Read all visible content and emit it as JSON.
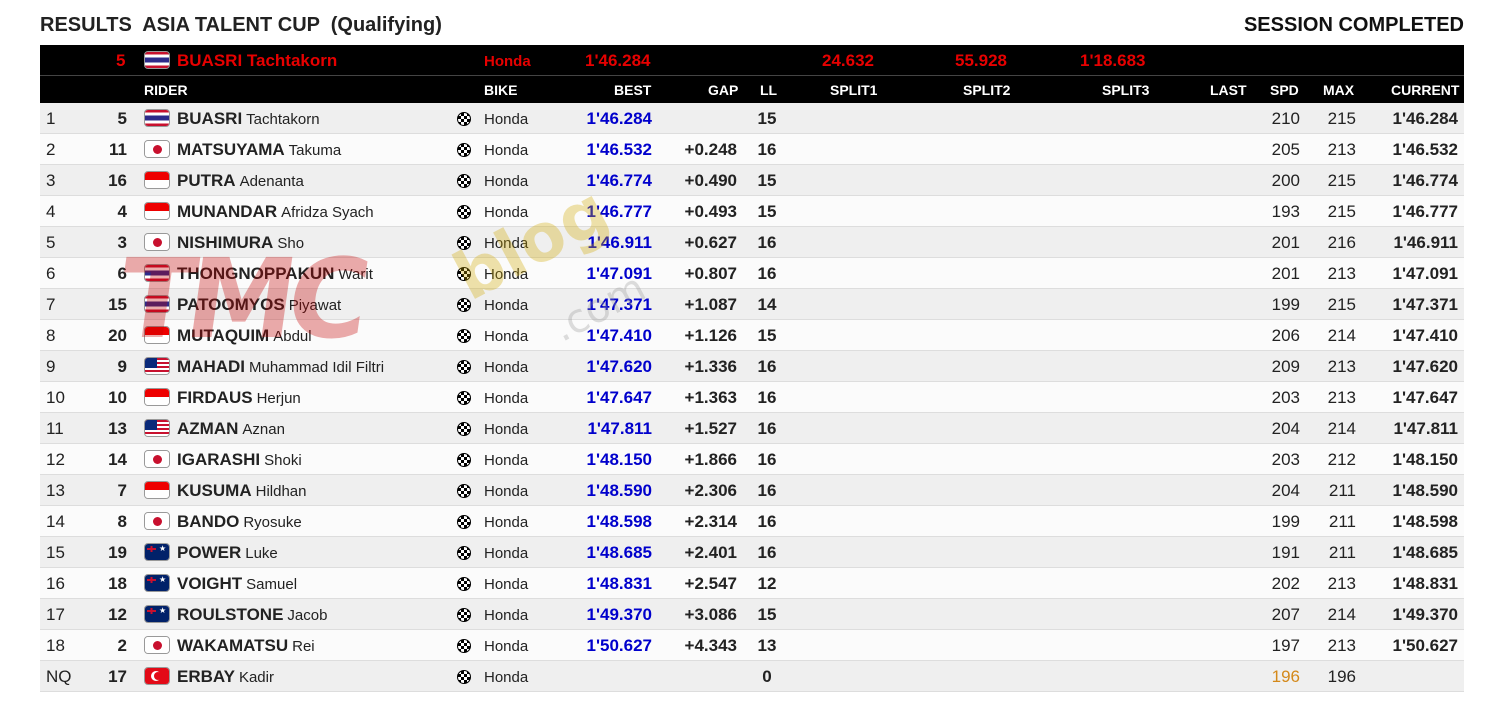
{
  "page": {
    "title": "RESULTS  ASIA TALENT CUP  (Qualifying)",
    "status": "SESSION COMPLETED"
  },
  "leader": {
    "number": "5",
    "flag": "flag-thailand",
    "rider": "BUASRI Tachtakorn",
    "bike": "Honda",
    "best": "1'46.284",
    "split1": "24.632",
    "split2": "55.928",
    "split3": "1'18.683"
  },
  "columns": {
    "rider": "RIDER",
    "bike": "BIKE",
    "best": "BEST",
    "gap": "GAP",
    "ll": "LL",
    "split1": "SPLIT1",
    "split2": "SPLIT2",
    "split3": "SPLIT3",
    "last": "LAST",
    "spd": "SPD",
    "max": "MAX",
    "current": "CURRENT"
  },
  "rows": [
    {
      "pos": "1",
      "num": "5",
      "flag": "th",
      "last_name": "BUASRI",
      "first_name": "Tachtakorn",
      "bike": "Honda",
      "best": "1'46.284",
      "gap": "",
      "ll": "15",
      "spd": "210",
      "max": "215",
      "current": "1'46.284"
    },
    {
      "pos": "2",
      "num": "11",
      "flag": "jp",
      "last_name": "MATSUYAMA",
      "first_name": "Takuma",
      "bike": "Honda",
      "best": "1'46.532",
      "gap": "+0.248",
      "ll": "16",
      "spd": "205",
      "max": "213",
      "current": "1'46.532"
    },
    {
      "pos": "3",
      "num": "16",
      "flag": "id",
      "last_name": "PUTRA",
      "first_name": "Adenanta",
      "bike": "Honda",
      "best": "1'46.774",
      "gap": "+0.490",
      "ll": "15",
      "spd": "200",
      "max": "215",
      "current": "1'46.774"
    },
    {
      "pos": "4",
      "num": "4",
      "flag": "id",
      "last_name": "MUNANDAR",
      "first_name": "Afridza Syach",
      "bike": "Honda",
      "best": "1'46.777",
      "gap": "+0.493",
      "ll": "15",
      "spd": "193",
      "max": "215",
      "current": "1'46.777"
    },
    {
      "pos": "5",
      "num": "3",
      "flag": "jp",
      "last_name": "NISHIMURA",
      "first_name": "Sho",
      "bike": "Honda",
      "best": "1'46.911",
      "gap": "+0.627",
      "ll": "16",
      "spd": "201",
      "max": "216",
      "current": "1'46.911"
    },
    {
      "pos": "6",
      "num": "6",
      "flag": "th",
      "last_name": "THONGNOPPAKUN",
      "first_name": "Warit",
      "bike": "Honda",
      "best": "1'47.091",
      "gap": "+0.807",
      "ll": "16",
      "spd": "201",
      "max": "213",
      "current": "1'47.091"
    },
    {
      "pos": "7",
      "num": "15",
      "flag": "th",
      "last_name": "PATOOMYOS",
      "first_name": "Piyawat",
      "bike": "Honda",
      "best": "1'47.371",
      "gap": "+1.087",
      "ll": "14",
      "spd": "199",
      "max": "215",
      "current": "1'47.371"
    },
    {
      "pos": "8",
      "num": "20",
      "flag": "id",
      "last_name": "MUTAQUIM",
      "first_name": "Abdul",
      "bike": "Honda",
      "best": "1'47.410",
      "gap": "+1.126",
      "ll": "15",
      "spd": "206",
      "max": "214",
      "current": "1'47.410"
    },
    {
      "pos": "9",
      "num": "9",
      "flag": "my",
      "last_name": "MAHADI",
      "first_name": "Muhammad Idil Filtri",
      "bike": "Honda",
      "best": "1'47.620",
      "gap": "+1.336",
      "ll": "16",
      "spd": "209",
      "max": "213",
      "current": "1'47.620"
    },
    {
      "pos": "10",
      "num": "10",
      "flag": "id",
      "last_name": "FIRDAUS",
      "first_name": "Herjun",
      "bike": "Honda",
      "best": "1'47.647",
      "gap": "+1.363",
      "ll": "16",
      "spd": "203",
      "max": "213",
      "current": "1'47.647"
    },
    {
      "pos": "11",
      "num": "13",
      "flag": "my",
      "last_name": "AZMAN",
      "first_name": "Aznan",
      "bike": "Honda",
      "best": "1'47.811",
      "gap": "+1.527",
      "ll": "16",
      "spd": "204",
      "max": "214",
      "current": "1'47.811"
    },
    {
      "pos": "12",
      "num": "14",
      "flag": "jp",
      "last_name": "IGARASHI",
      "first_name": "Shoki",
      "bike": "Honda",
      "best": "1'48.150",
      "gap": "+1.866",
      "ll": "16",
      "spd": "203",
      "max": "212",
      "current": "1'48.150"
    },
    {
      "pos": "13",
      "num": "7",
      "flag": "id",
      "last_name": "KUSUMA",
      "first_name": "Hildhan",
      "bike": "Honda",
      "best": "1'48.590",
      "gap": "+2.306",
      "ll": "16",
      "spd": "204",
      "max": "211",
      "current": "1'48.590"
    },
    {
      "pos": "14",
      "num": "8",
      "flag": "jp",
      "last_name": "BANDO",
      "first_name": "Ryosuke",
      "bike": "Honda",
      "best": "1'48.598",
      "gap": "+2.314",
      "ll": "16",
      "spd": "199",
      "max": "211",
      "current": "1'48.598"
    },
    {
      "pos": "15",
      "num": "19",
      "flag": "au",
      "last_name": "POWER",
      "first_name": "Luke",
      "bike": "Honda",
      "best": "1'48.685",
      "gap": "+2.401",
      "ll": "16",
      "spd": "191",
      "max": "211",
      "current": "1'48.685"
    },
    {
      "pos": "16",
      "num": "18",
      "flag": "au",
      "last_name": "VOIGHT",
      "first_name": "Samuel",
      "bike": "Honda",
      "best": "1'48.831",
      "gap": "+2.547",
      "ll": "12",
      "spd": "202",
      "max": "213",
      "current": "1'48.831"
    },
    {
      "pos": "17",
      "num": "12",
      "flag": "au",
      "last_name": "ROULSTONE",
      "first_name": "Jacob",
      "bike": "Honda",
      "best": "1'49.370",
      "gap": "+3.086",
      "ll": "15",
      "spd": "207",
      "max": "214",
      "current": "1'49.370"
    },
    {
      "pos": "18",
      "num": "2",
      "flag": "jp",
      "last_name": "WAKAMATSU",
      "first_name": "Rei",
      "bike": "Honda",
      "best": "1'50.627",
      "gap": "+4.343",
      "ll": "13",
      "spd": "197",
      "max": "213",
      "current": "1'50.627"
    },
    {
      "pos": "NQ",
      "num": "17",
      "flag": "tr",
      "last_name": "ERBAY",
      "first_name": "Kadir",
      "bike": "Honda",
      "best": "",
      "gap": "",
      "ll": "0",
      "spd": "196",
      "max": "196",
      "current": "",
      "spd_color": "#d4891a"
    }
  ],
  "colors": {
    "leader_text": "#e60000",
    "best_time": "#0000cc",
    "header_bg": "#000000",
    "nq_speed": "#d4891a"
  },
  "watermark": {
    "main": "TMC",
    "blog": "blog",
    "com": ".com"
  }
}
